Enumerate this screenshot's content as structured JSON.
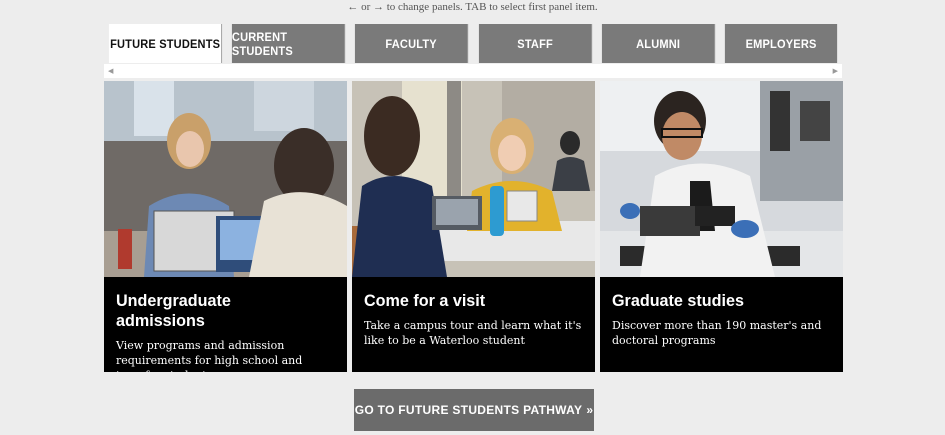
{
  "hint": "← or → to change panels. TAB to select first panel item.",
  "tabs": [
    {
      "label": "FUTURE STUDENTS",
      "active": true
    },
    {
      "label": "CURRENT STUDENTS",
      "active": false
    },
    {
      "label": "FACULTY",
      "active": false
    },
    {
      "label": "STAFF",
      "active": false
    },
    {
      "label": "ALUMNI",
      "active": false
    },
    {
      "label": "EMPLOYERS",
      "active": false
    }
  ],
  "cards": [
    {
      "title": "Undergraduate admissions",
      "description": "View programs and admission requirements for high school and transfer students"
    },
    {
      "title": "Come for a visit",
      "description": "Take a campus tour and learn what it's like to be a Waterloo student"
    },
    {
      "title": "Graduate studies",
      "description": "Discover more than 190 master's and doctoral programs"
    }
  ],
  "cta": {
    "label": "GO TO FUTURE STUDENTS PATHWAY",
    "arrow": "»"
  }
}
